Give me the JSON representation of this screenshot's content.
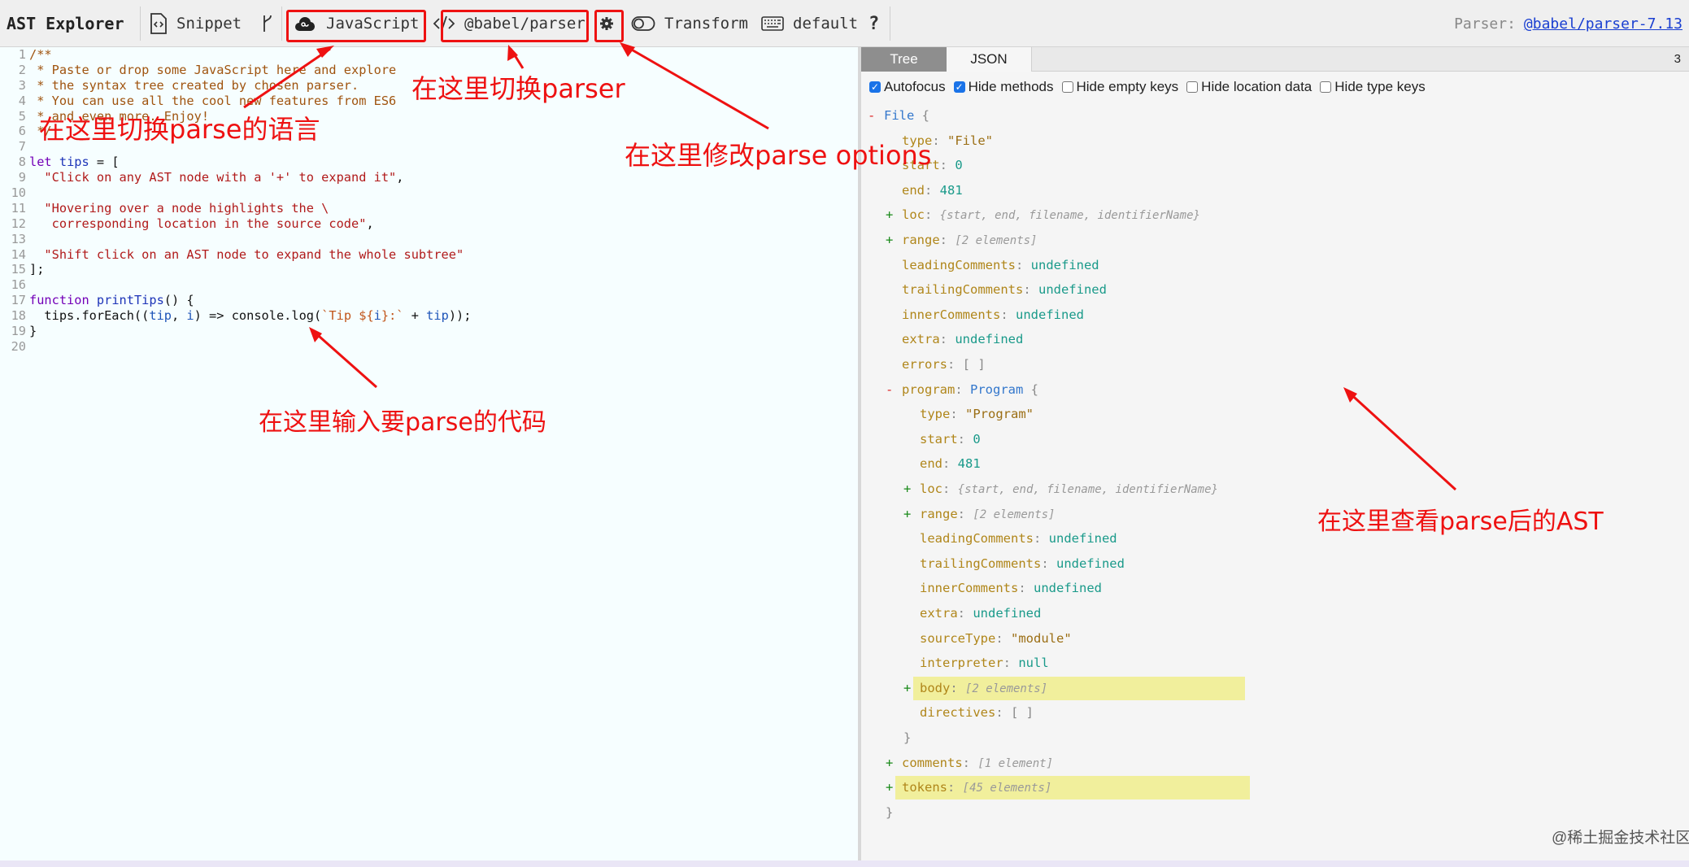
{
  "toolbar": {
    "app_title": "AST Explorer",
    "snippet_label": "Snippet",
    "language_label": "JavaScript",
    "parser_label": "@babel/parser",
    "transform_label": "Transform",
    "keymap_label": "default",
    "help_label": "?",
    "parser_info_label": "Parser:",
    "parser_info_value": "@babel/parser-7.13"
  },
  "editor": {
    "line_numbers": [
      "1",
      "2",
      "3",
      "4",
      "5",
      "6",
      "7",
      "8",
      "9",
      "10",
      "11",
      "12",
      "13",
      "14",
      "15",
      "16",
      "17",
      "18",
      "19",
      "20"
    ]
  },
  "output": {
    "tabs": [
      "Tree",
      "JSON"
    ],
    "count": "3",
    "options": [
      {
        "label": "Autofocus",
        "checked": true
      },
      {
        "label": "Hide methods",
        "checked": true
      },
      {
        "label": "Hide empty keys",
        "checked": false
      },
      {
        "label": "Hide location data",
        "checked": false
      },
      {
        "label": "Hide type keys",
        "checked": false
      }
    ],
    "tree": [
      {
        "indent": 0,
        "toggle": "-",
        "key": "File",
        "type": "",
        "value": "",
        "vclass": "",
        "suffix": "{"
      },
      {
        "indent": 1,
        "toggle": "",
        "key": "type",
        "type": "",
        "value": "\"File\"",
        "vclass": "s",
        "suffix": ""
      },
      {
        "indent": 1,
        "toggle": "",
        "key": "start",
        "type": "",
        "value": "0",
        "vclass": "n",
        "suffix": ""
      },
      {
        "indent": 1,
        "toggle": "",
        "key": "end",
        "type": "",
        "value": "481",
        "vclass": "n",
        "suffix": ""
      },
      {
        "indent": 1,
        "toggle": "+",
        "key": "loc",
        "type": "",
        "value": "{start, end, filename, identifierName}",
        "vclass": "sum",
        "suffix": ""
      },
      {
        "indent": 1,
        "toggle": "+",
        "key": "range",
        "type": "",
        "value": "[2 elements]",
        "vclass": "sum",
        "suffix": ""
      },
      {
        "indent": 1,
        "toggle": "",
        "key": "leadingComments",
        "type": "",
        "value": "undefined",
        "vclass": "u",
        "suffix": ""
      },
      {
        "indent": 1,
        "toggle": "",
        "key": "trailingComments",
        "type": "",
        "value": "undefined",
        "vclass": "u",
        "suffix": ""
      },
      {
        "indent": 1,
        "toggle": "",
        "key": "innerComments",
        "type": "",
        "value": "undefined",
        "vclass": "u",
        "suffix": ""
      },
      {
        "indent": 1,
        "toggle": "",
        "key": "extra",
        "type": "",
        "value": "undefined",
        "vclass": "u",
        "suffix": ""
      },
      {
        "indent": 1,
        "toggle": "",
        "key": "errors",
        "type": "",
        "value": "[ ]",
        "vclass": "p",
        "suffix": ""
      },
      {
        "indent": 1,
        "toggle": "-",
        "key": "program",
        "type": "Program",
        "value": "",
        "vclass": "",
        "suffix": "{"
      },
      {
        "indent": 2,
        "toggle": "",
        "key": "type",
        "type": "",
        "value": "\"Program\"",
        "vclass": "s",
        "suffix": ""
      },
      {
        "indent": 2,
        "toggle": "",
        "key": "start",
        "type": "",
        "value": "0",
        "vclass": "n",
        "suffix": ""
      },
      {
        "indent": 2,
        "toggle": "",
        "key": "end",
        "type": "",
        "value": "481",
        "vclass": "n",
        "suffix": ""
      },
      {
        "indent": 2,
        "toggle": "+",
        "key": "loc",
        "type": "",
        "value": "{start, end, filename, identifierName}",
        "vclass": "sum",
        "suffix": ""
      },
      {
        "indent": 2,
        "toggle": "+",
        "key": "range",
        "type": "",
        "value": "[2 elements]",
        "vclass": "sum",
        "suffix": ""
      },
      {
        "indent": 2,
        "toggle": "",
        "key": "leadingComments",
        "type": "",
        "value": "undefined",
        "vclass": "u",
        "suffix": ""
      },
      {
        "indent": 2,
        "toggle": "",
        "key": "trailingComments",
        "type": "",
        "value": "undefined",
        "vclass": "u",
        "suffix": ""
      },
      {
        "indent": 2,
        "toggle": "",
        "key": "innerComments",
        "type": "",
        "value": "undefined",
        "vclass": "u",
        "suffix": ""
      },
      {
        "indent": 2,
        "toggle": "",
        "key": "extra",
        "type": "",
        "value": "undefined",
        "vclass": "u",
        "suffix": ""
      },
      {
        "indent": 2,
        "toggle": "",
        "key": "sourceType",
        "type": "",
        "value": "\"module\"",
        "vclass": "s",
        "suffix": ""
      },
      {
        "indent": 2,
        "toggle": "",
        "key": "interpreter",
        "type": "",
        "value": "null",
        "vclass": "n",
        "suffix": ""
      },
      {
        "indent": 2,
        "toggle": "+",
        "key": "body",
        "type": "",
        "value": "[2 elements]",
        "vclass": "sum",
        "suffix": "",
        "highlight": true
      },
      {
        "indent": 2,
        "toggle": "",
        "key": "directives",
        "type": "",
        "value": "[ ]",
        "vclass": "p",
        "suffix": ""
      },
      {
        "indent": 2,
        "toggle": "",
        "key": "",
        "type": "",
        "value": "}",
        "vclass": "p",
        "suffix": "",
        "closing": true
      },
      {
        "indent": 1,
        "toggle": "+",
        "key": "comments",
        "type": "",
        "value": "[1 element]",
        "vclass": "sum",
        "suffix": ""
      },
      {
        "indent": 1,
        "toggle": "+",
        "key": "tokens",
        "type": "",
        "value": "[45 elements]",
        "vclass": "sum",
        "suffix": "",
        "highlight": true
      },
      {
        "indent": 1,
        "toggle": "",
        "key": "",
        "type": "",
        "value": "}",
        "vclass": "p",
        "suffix": "",
        "closing": true
      }
    ]
  },
  "annotations": {
    "switch_language": "在这里切换parse的语言",
    "switch_parser": "在这里切换parser",
    "modify_options": "在这里修改parse options",
    "input_code": "在这里输入要parse的代码",
    "view_ast": "在这里查看parse后的AST"
  },
  "watermark": "@稀土掘金技术社区",
  "colors": {
    "annotation": "#ee1111",
    "highlight": "#f1ef9c",
    "active_tab": "#8e8e8e"
  }
}
